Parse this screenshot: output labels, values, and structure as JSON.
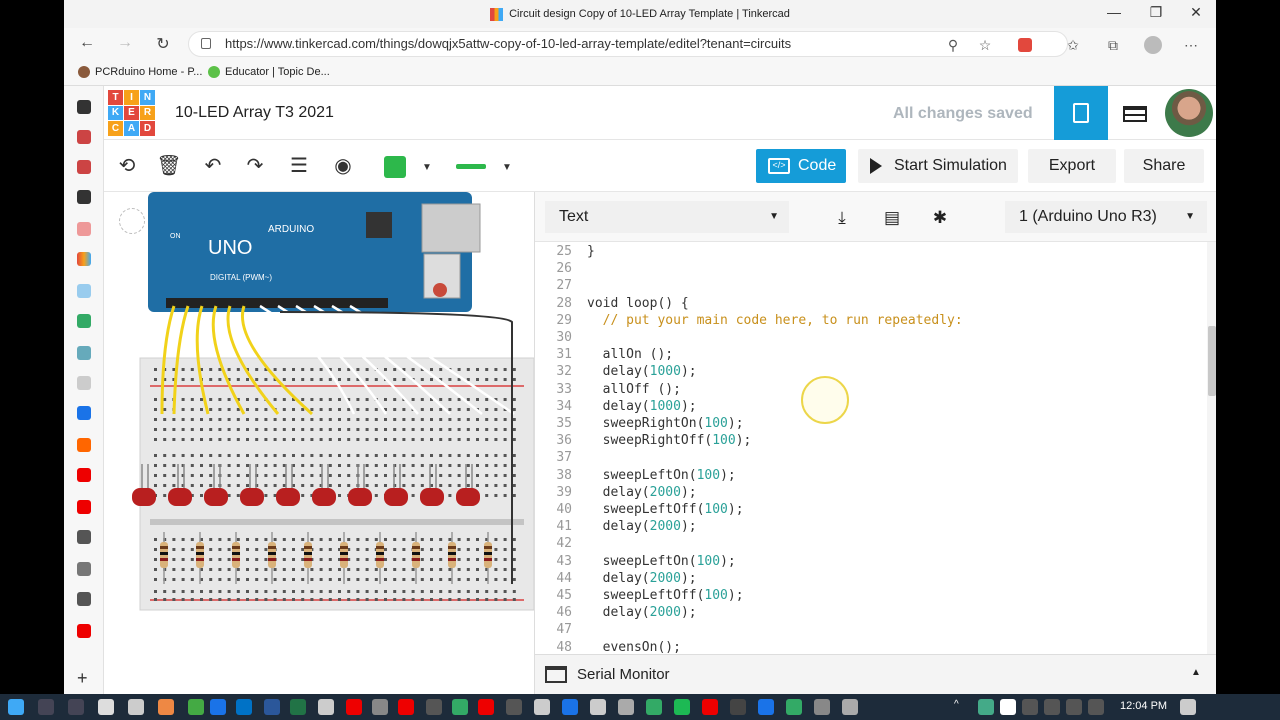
{
  "browser": {
    "title": "Circuit design Copy of 10-LED Array Template | Tinkercad",
    "url": "https://www.tinkercad.com/things/dowqjx5attw-copy-of-10-led-array-template/editel?tenant=circuits",
    "bookmarks": [
      {
        "label": "PCRduino Home - P...",
        "color": "#8a5a3c"
      },
      {
        "label": "Educator | Topic De...",
        "color": "#5cc148"
      }
    ]
  },
  "app": {
    "logo_letters": [
      "T",
      "I",
      "N",
      "K",
      "E",
      "R",
      "C",
      "A",
      "D"
    ],
    "logo_colors": [
      "#e2483d",
      "#f7a11a",
      "#3fa9f5",
      "#3fa9f5",
      "#e2483d",
      "#f7a11a",
      "#f7a11a",
      "#3fa9f5",
      "#e2483d"
    ],
    "project_title": "10-LED Array T3 2021",
    "save_status": "All changes saved"
  },
  "toolbar": {
    "code_label": "Code",
    "start_sim_label": "Start Simulation",
    "export_label": "Export",
    "share_label": "Share",
    "component_color": "#2db84b"
  },
  "code_panel": {
    "mode": "Text",
    "device": "1 (Arduino Uno R3)",
    "serial_monitor_label": "Serial Monitor",
    "lines": [
      {
        "n": "25",
        "code": "}"
      },
      {
        "n": "26",
        "code": ""
      },
      {
        "n": "27",
        "code": ""
      },
      {
        "n": "28",
        "code": "void loop() {"
      },
      {
        "n": "29",
        "code": "  // put your main code here, to run repeatedly:"
      },
      {
        "n": "30",
        "code": ""
      },
      {
        "n": "31",
        "code": "  allOn ();"
      },
      {
        "n": "32",
        "code": "  delay(1000);"
      },
      {
        "n": "33",
        "code": "  allOff ();"
      },
      {
        "n": "34",
        "code": "  delay(1000);"
      },
      {
        "n": "35",
        "code": "  sweepRightOn(100);"
      },
      {
        "n": "36",
        "code": "  sweepRightOff(100);"
      },
      {
        "n": "37",
        "code": ""
      },
      {
        "n": "38",
        "code": "  sweepLeftOn(100);"
      },
      {
        "n": "39",
        "code": "  delay(2000);"
      },
      {
        "n": "40",
        "code": "  sweepLeftOff(100);"
      },
      {
        "n": "41",
        "code": "  delay(2000);"
      },
      {
        "n": "42",
        "code": ""
      },
      {
        "n": "43",
        "code": "  sweepLeftOn(100);"
      },
      {
        "n": "44",
        "code": "  delay(2000);"
      },
      {
        "n": "45",
        "code": "  sweepLeftOff(100);"
      },
      {
        "n": "46",
        "code": "  delay(2000);"
      },
      {
        "n": "47",
        "code": ""
      },
      {
        "n": "48",
        "code": "  evensOn();"
      }
    ]
  },
  "board": {
    "brand": "ARDUINO",
    "model": "UNO",
    "digital_label": "DIGITAL (PWM~)",
    "on_label": "ON"
  },
  "taskbar": {
    "time": "12:04 PM"
  }
}
